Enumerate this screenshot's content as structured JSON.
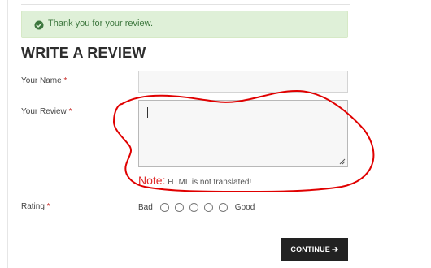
{
  "alert": {
    "message": "Thank you for your review.",
    "icon": "check-circle-icon"
  },
  "form": {
    "title": "WRITE A REVIEW",
    "name_label": "Your Name",
    "review_label": "Your Review",
    "rating_label": "Rating",
    "required_mark": "*",
    "note_prefix": "Note:",
    "note_text": "HTML is not translated!",
    "rating_bad": "Bad",
    "rating_good": "Good",
    "rating_options": [
      "1",
      "2",
      "3",
      "4",
      "5"
    ]
  },
  "actions": {
    "continue_label": "CONTINUE",
    "continue_icon": "arrow-right-icon"
  },
  "colors": {
    "alert_bg": "#dff0d8",
    "alert_text": "#3c763d",
    "required": "#c9302c",
    "note_prefix": "#e02b2b",
    "annotation": "#e00000",
    "button_bg": "#222222"
  }
}
